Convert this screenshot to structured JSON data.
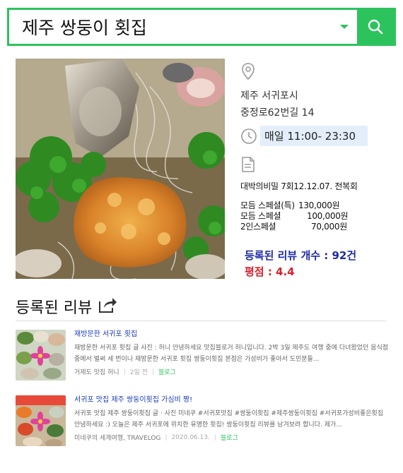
{
  "search": {
    "query": "제주 쌍둥이 횟집"
  },
  "colors": {
    "accent": "#2cc35d",
    "review_count": "#1f2aa8",
    "rating": "#d9202a",
    "hours_bg": "#e3eefa"
  },
  "place": {
    "address_line1": "제주 서귀포시",
    "address_line2": "중정로62번길 14",
    "hours": "매일 11:00- 23:30",
    "menu_title": "대박의비밀 7회12.12.07. 전복회",
    "prices": [
      {
        "name": "모듬 스페셜(특)",
        "price": "130,000원"
      },
      {
        "name": "모듬 스페셜",
        "price": "100,000원"
      },
      {
        "name": "2인스페셜",
        "price": "70,000원"
      }
    ],
    "review_count_label": "등록된 리뷰 개수 : 92건",
    "rating_label": "평점 : 4.4"
  },
  "icons": {
    "location": "location-pin-icon",
    "clock": "clock-icon",
    "document": "document-icon",
    "share": "share-icon",
    "search": "search-icon"
  },
  "reviews": {
    "heading": "등록된 리뷰",
    "items": [
      {
        "title": "재방문한 서귀포 횟집",
        "snippet": "재방문한 서귀포 횟집 글 사진 : 허니 안녕하세요 맛집블로거 허니입니다. 2박 3일 제주도 여행 중에 다녀왔었던 음식점 중에서 벌써 세 번이나 재방문한 서귀포 횟집 쌍둥이횟집 본점은 가성비가 좋아서 도민분들...",
        "author": "거제도 맛집 허니",
        "date": "2일 전",
        "source": "블로그"
      },
      {
        "title": "서귀포 맛집 제주 쌍둥이횟집 가심비 짱!",
        "snippet": "서귀포 맛집 제주 쌍둥이횟집 글 · 사진 미네쿠 #서귀포맛집 #쌍둥이횟집 #제주쌍둥이횟집 #서귀포가성비좋은횟집 안녕하세요 :) 오늘은 제주 서귀포에 위치한 유명한 횟집! 쌍둥이횟집 리뷰를 남겨보려 합니다. 제가...",
        "author": "미네쿠의 세계여행, TRAVELOG",
        "date": "2020.06.13.",
        "source": "블로그"
      }
    ]
  }
}
